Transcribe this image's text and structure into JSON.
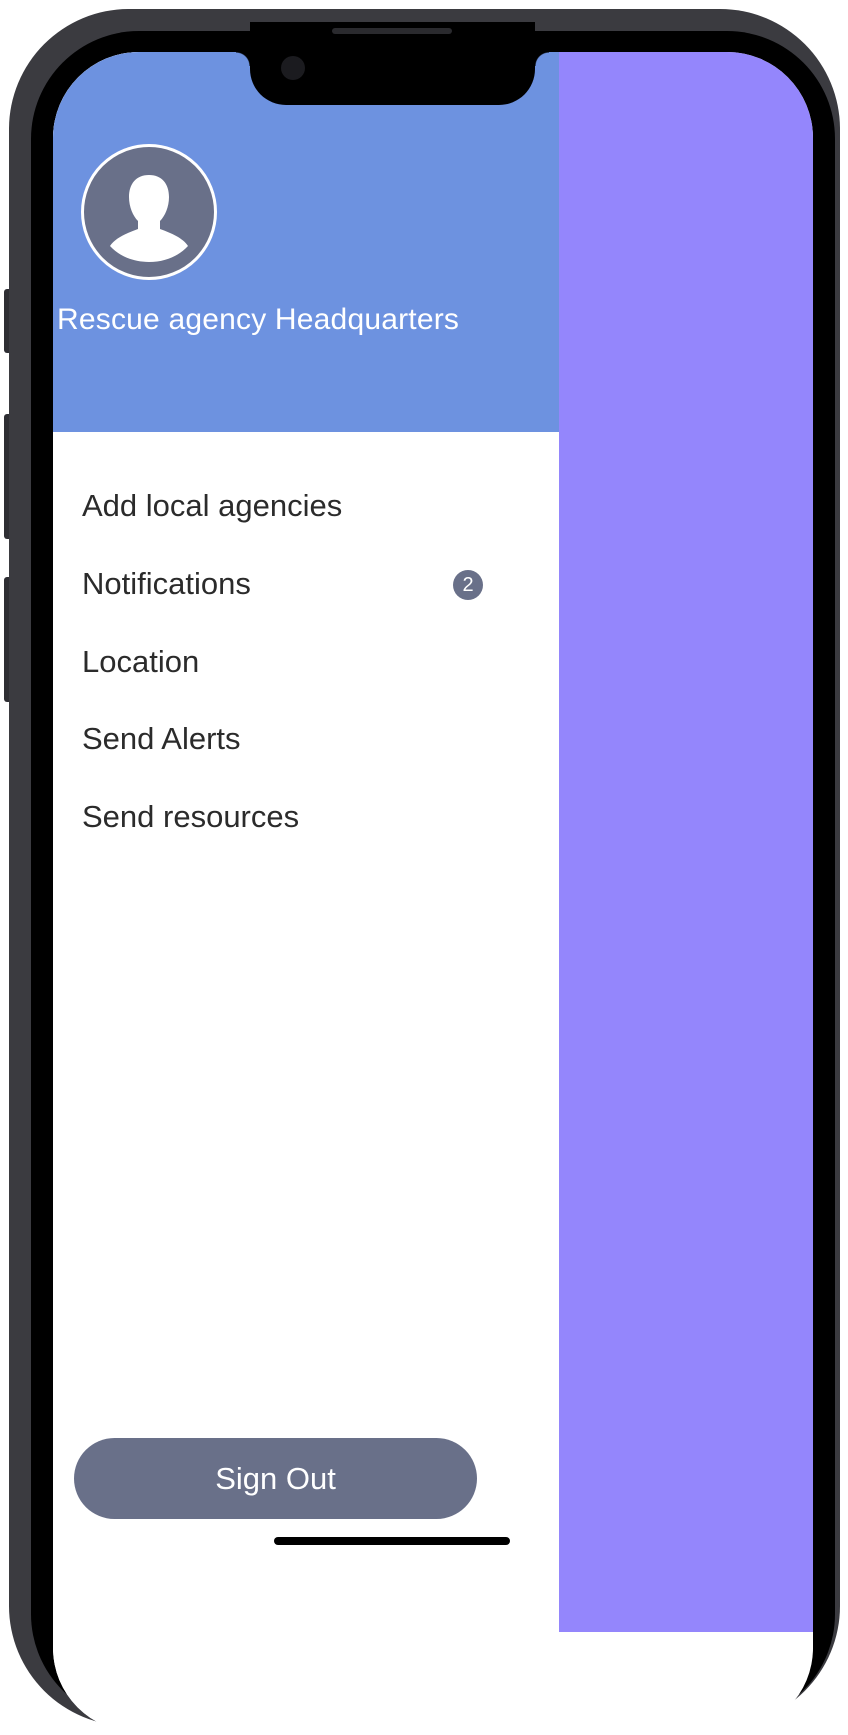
{
  "drawer": {
    "header": {
      "agency_name": "Rescue agency Headquarters",
      "background_color": "#6d92e0",
      "avatar_icon": "person-silhouette-icon"
    },
    "menu": [
      {
        "label": "Add local agencies"
      },
      {
        "label": "Notifications",
        "badge": "2"
      },
      {
        "label": "Location"
      },
      {
        "label": "Send Alerts"
      },
      {
        "label": "Send resources"
      }
    ],
    "sign_out_label": "Sign Out",
    "button_color": "#697089"
  },
  "main": {
    "background_color": "#9486fc"
  }
}
